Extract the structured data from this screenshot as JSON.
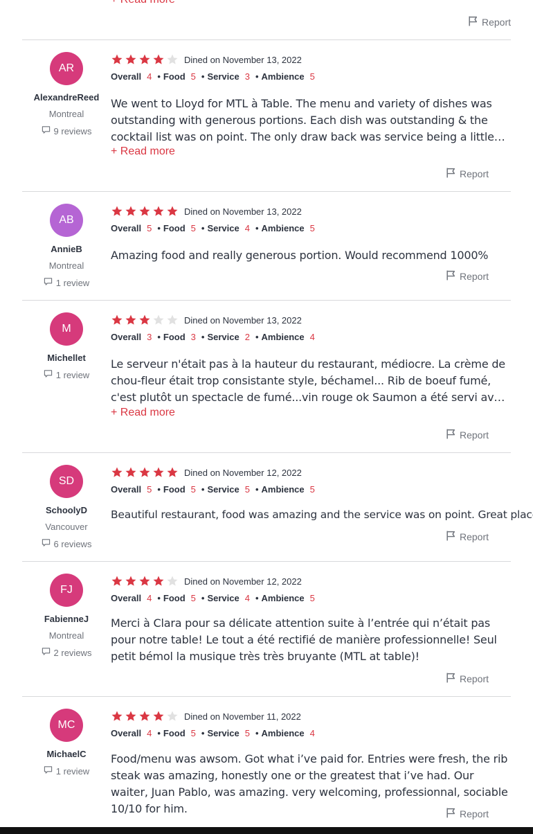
{
  "top_stub": {
    "read_more": "+ Read more",
    "report": "Report"
  },
  "reviews": [
    {
      "initials": "AR",
      "avatar_color": "#d63a7b",
      "name": "AlexandreReed",
      "location": "Montreal",
      "count": "9 reviews",
      "stars": 4,
      "dined": "Dined on November 13, 2022",
      "overall": "4",
      "food": "5",
      "service": "3",
      "ambience": "5",
      "text": "We went to Lloyd for MTL à Table. The menu and variety of dishes was outstanding with generous portions. Each dish was outstanding & the cocktail list was on point. The only draw back was service being a little chaotic from forgetting twice to give us our bread...",
      "read_more": "+ Read more",
      "report": "Report"
    },
    {
      "initials": "AB",
      "avatar_color": "#b565d4",
      "name": "AnnieB",
      "location": "Montreal",
      "count": "1 review",
      "stars": 5,
      "dined": "Dined on November 13, 2022",
      "overall": "5",
      "food": "5",
      "service": "4",
      "ambience": "5",
      "text": "Amazing food and really generous portion. Would recommend 1000%",
      "report": "Report"
    },
    {
      "initials": "M",
      "avatar_color": "#d63a7b",
      "name": "Michellet",
      "location": "",
      "count": "1 review",
      "stars": 3,
      "dined": "Dined on November 13, 2022",
      "overall": "3",
      "food": "3",
      "service": "2",
      "ambience": "4",
      "text": "Le serveur n'était pas à la hauteur du restaurant, médiocre. La crème de chou-fleur était trop consistante style, béchamel... Rib de boeuf fumé, c'est plutôt un spectacle de fumé...vin rouge ok Saumon a été servi avec le vin rouge et non le vin blanc...",
      "read_more": "+ Read more",
      "report": "Report"
    },
    {
      "initials": "SD",
      "avatar_color": "#d63a7b",
      "name": "SchoolyD",
      "location": "Vancouver",
      "count": "6 reviews",
      "stars": 5,
      "dined": "Dined on November 12, 2022",
      "overall": "5",
      "food": "5",
      "service": "5",
      "ambience": "5",
      "text": "Beautiful restaurant, food was amazing and the service was on point. Great place!!",
      "report": "Report"
    },
    {
      "initials": "FJ",
      "avatar_color": "#d63a7b",
      "name": "FabienneJ",
      "location": "Montreal",
      "count": "2 reviews",
      "stars": 4,
      "dined": "Dined on November 12, 2022",
      "overall": "4",
      "food": "5",
      "service": "4",
      "ambience": "5",
      "text": "Merci à Clara pour sa délicate attention suite à l’entrée qui n’était pas pour notre table! Le tout a été rectifié de manière professionnelle! Seul petit bémol la musique très très bruyante (MTL at table)!",
      "report": "Report"
    },
    {
      "initials": "MC",
      "avatar_color": "#d63a7b",
      "name": "MichaelC",
      "location": "",
      "count": "1 review",
      "stars": 4,
      "dined": "Dined on November 11, 2022",
      "overall": "4",
      "food": "5",
      "service": "5",
      "ambience": "4",
      "text": "Food/menu was awsom. Got what i’ve paid for. Entries were fresh, the rib steak was amazing, honestly one or the greatest that i’ve had. Our waiter, Juan Pablo, was amazing. very welcoming, professionnal, sociable 10/10 for him.",
      "report": "Report"
    }
  ],
  "labels": {
    "overall": "Overall",
    "food": "Food",
    "service": "Service",
    "ambience": "Ambience",
    "sep": "•"
  },
  "colors": {
    "accent": "#da3743",
    "star_empty": "#e1e1e1",
    "divider": "#d8d9db"
  }
}
